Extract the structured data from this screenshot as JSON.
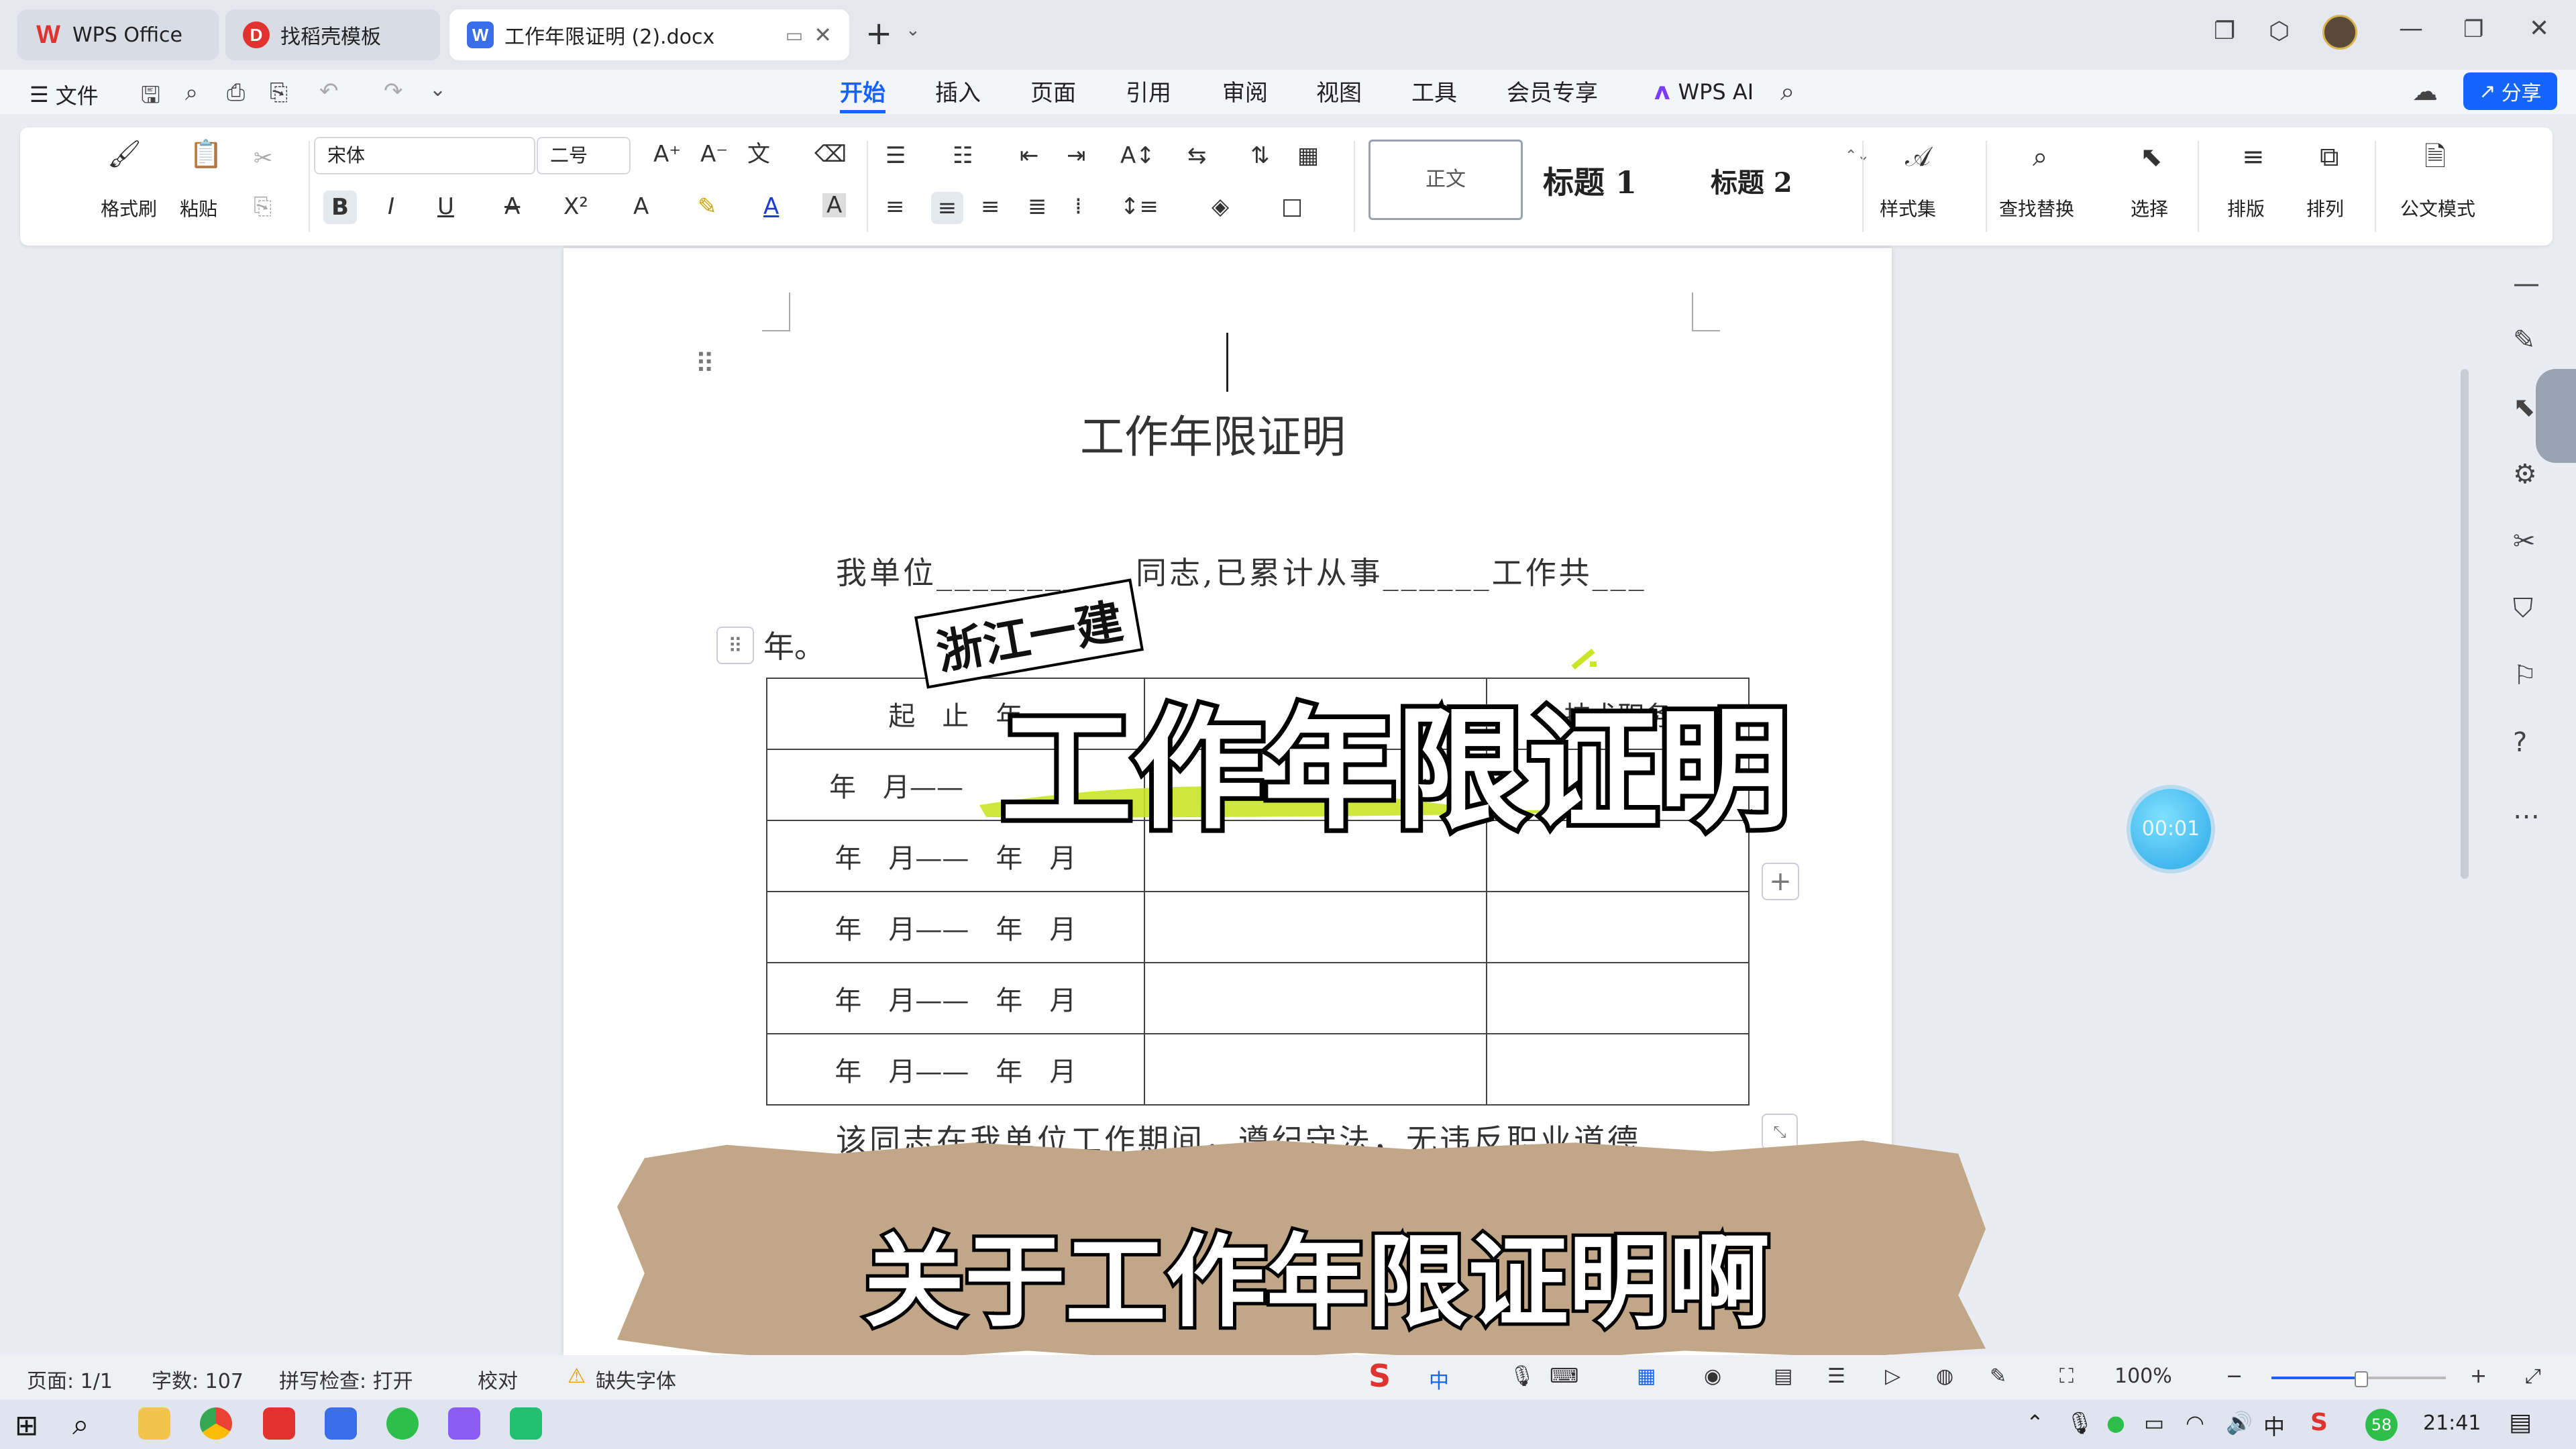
{
  "tabs": [
    {
      "label": "WPS Office",
      "icon": "wps-logo-icon"
    },
    {
      "label": "找稻壳模板",
      "icon": "daoke-icon"
    },
    {
      "label": "工作年限证明 (2).docx",
      "icon": "word-doc-icon",
      "active": true
    }
  ],
  "menu": {
    "file_label": "文件",
    "tabs": [
      "开始",
      "插入",
      "页面",
      "引用",
      "审阅",
      "视图",
      "工具",
      "会员专享"
    ],
    "selected": "开始",
    "wps_ai_label": "WPS AI",
    "share_label": "分享"
  },
  "ribbon": {
    "format_painter": "格式刷",
    "paste": "粘贴",
    "font_name": "宋体",
    "font_size": "二号",
    "styles": [
      "正文",
      "标题 1",
      "标题 2"
    ],
    "style_set": "样式集",
    "find_replace": "查找替换",
    "select": "选择",
    "typeset": "排版",
    "arrange": "排列",
    "official_mode": "公文模式"
  },
  "document": {
    "title": "工作年限证明",
    "para1_line1": "我单位___________同志,已累计从事______工作共___",
    "para1_line2": "年。",
    "table": {
      "header_left": "起　止　年",
      "header_right": "技术职务",
      "first_row_left": "年　月——",
      "rows": [
        [
          "年　月——　年　月",
          "",
          ""
        ],
        [
          "年　月——　年　月",
          "",
          ""
        ],
        [
          "年　月——　年　月",
          "",
          ""
        ],
        [
          "年　月——　年　月",
          "",
          ""
        ]
      ]
    },
    "para2": "该同志在我单位工作期间，遵纪守法，无违反职业道德"
  },
  "overlays": {
    "tag": "浙江一建",
    "big_title": "工作年限证明",
    "subtitle": "关于工作年限证明啊",
    "timer": "00:01"
  },
  "status": {
    "page": "页面: 1/1",
    "words": "字数: 107",
    "spell": "拼写检查: 打开",
    "proof": "校对",
    "missing_font": "缺失字体",
    "zoom": "100%"
  },
  "taskbar": {
    "time": "21:41",
    "ime": "中",
    "badge": "58"
  },
  "colors": {
    "accent": "#1664ff",
    "wps_red": "#e0322f",
    "word_blue": "#3a6ee8"
  }
}
